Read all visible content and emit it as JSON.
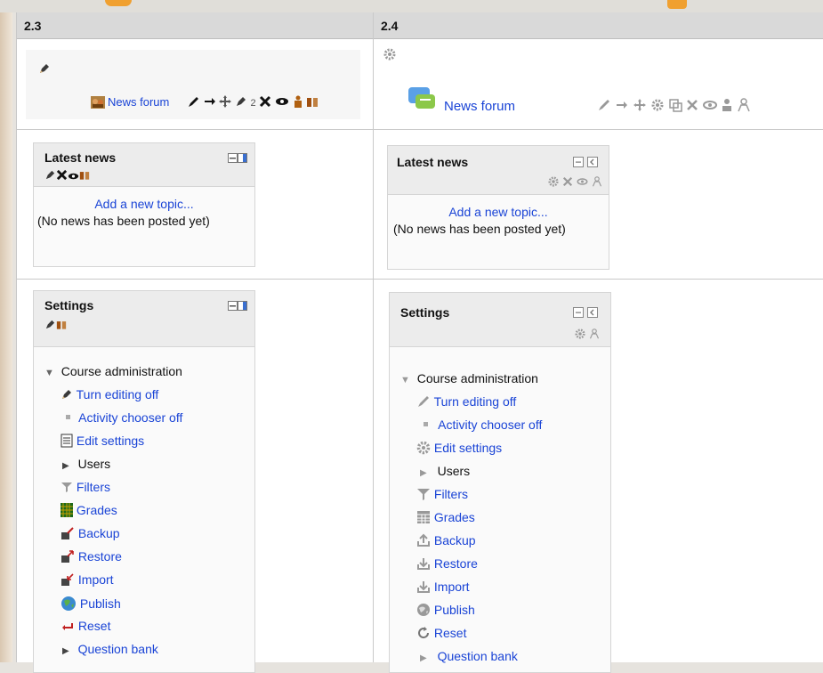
{
  "columns": {
    "left": "2.3",
    "right": "2.4"
  },
  "forum_row": {
    "left_link": "News forum",
    "left_group_count": "2",
    "right_link": "News forum"
  },
  "latest_news": {
    "left": {
      "title": "Latest news",
      "add_link": "Add a new topic...",
      "empty_text": "(No news has been posted yet)"
    },
    "right": {
      "title": "Latest news",
      "add_link": "Add a new topic...",
      "empty_text": "(No news has been posted yet)"
    }
  },
  "settings": {
    "left": {
      "title": "Settings",
      "section": "Course administration",
      "items": [
        "Turn editing off",
        "Activity chooser off",
        "Edit settings",
        "Users",
        "Filters",
        "Grades",
        "Backup",
        "Restore",
        "Import",
        "Publish",
        "Reset",
        "Question bank"
      ]
    },
    "right": {
      "title": "Settings",
      "section": "Course administration",
      "items": [
        "Turn editing off",
        "Activity chooser off",
        "Edit settings",
        "Users",
        "Filters",
        "Grades",
        "Backup",
        "Restore",
        "Import",
        "Publish",
        "Reset",
        "Question bank"
      ]
    }
  },
  "colors": {
    "link": "#1a44d6",
    "header_bg": "#d9d9d9",
    "accent_orange": "#f0a030"
  }
}
